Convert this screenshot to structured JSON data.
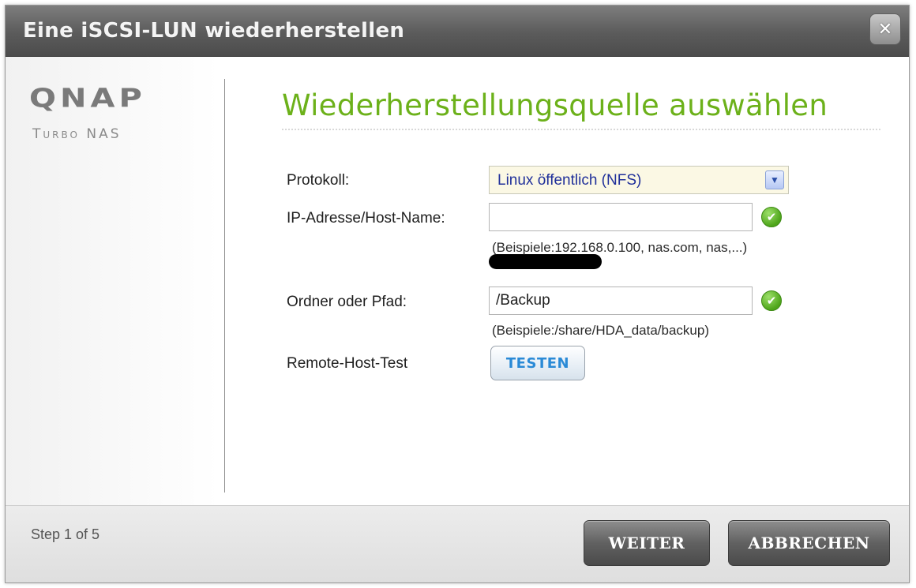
{
  "window": {
    "title": "Eine iSCSI-LUN wiederherstellen",
    "close_glyph": "✕"
  },
  "logo": {
    "main": "QNAP",
    "sub": "Turbo NAS"
  },
  "section": {
    "title": "Wiederherstellungsquelle auswählen"
  },
  "form": {
    "protocol_label": "Protokoll:",
    "protocol_value": "Linux öffentlich (NFS)",
    "host_label": "IP-Adresse/Host-Name:",
    "host_hint": "(Beispiele:192.168.0.100, nas.com, nas,...)",
    "path_label": "Ordner oder Pfad:",
    "path_value": "/Backup",
    "path_hint": "(Beispiele:/share/HDA_data/backup)",
    "test_label": "Remote-Host-Test",
    "test_button": "TESTEN"
  },
  "footer": {
    "step": "Step 1 of 5",
    "next_button": "WEITER",
    "cancel_button": "ABBRECHEN"
  },
  "icons": {
    "check": "✔",
    "dropdown": "▼"
  },
  "colors": {
    "accent_green": "#6cb11a",
    "select_text": "#20309a",
    "test_button_text": "#2a8ad6"
  }
}
